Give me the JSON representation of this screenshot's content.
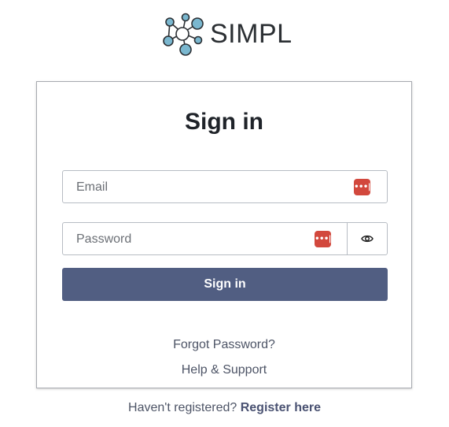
{
  "brand": {
    "name": "SIMPL",
    "icon": "molecule-network-icon"
  },
  "form": {
    "title": "Sign in",
    "email": {
      "placeholder": "Email",
      "value": ""
    },
    "password": {
      "placeholder": "Password",
      "value": ""
    },
    "password_manager_icon": "password-manager-icon",
    "toggle_visibility_icon": "eye-icon",
    "submit_label": "Sign in"
  },
  "links": {
    "forgot_password": "Forgot Password?",
    "help_support": "Help & Support"
  },
  "footer": {
    "prompt": "Haven't registered?",
    "register_label": "Register here"
  },
  "colors": {
    "primary_button": "#515e82",
    "password_manager": "#d2483d",
    "logo_node": "#7ab7cf"
  }
}
